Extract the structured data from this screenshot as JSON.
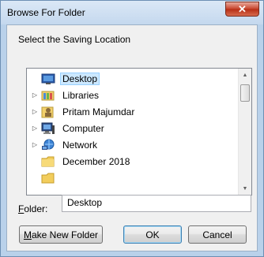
{
  "window": {
    "title": "Browse For Folder",
    "close_glyph": "✕"
  },
  "prompt": "Select the Saving Location",
  "tree": {
    "items": [
      {
        "label": "Desktop",
        "icon": "desktop-icon",
        "expander": "",
        "selected": true
      },
      {
        "label": "Libraries",
        "icon": "libraries-icon",
        "expander": "▷"
      },
      {
        "label": "Pritam Majumdar",
        "icon": "user-folder-icon",
        "expander": "▷"
      },
      {
        "label": "Computer",
        "icon": "computer-icon",
        "expander": "▷"
      },
      {
        "label": "Network",
        "icon": "network-icon",
        "expander": "▷"
      },
      {
        "label": "December 2018",
        "icon": "folder-icon",
        "expander": ""
      }
    ]
  },
  "folder": {
    "label_prefix": "F",
    "label_rest": "older:",
    "value": "Desktop"
  },
  "buttons": {
    "make_new_folder_mnemonic": "M",
    "make_new_folder_rest": "ake New Folder",
    "ok": "OK",
    "cancel": "Cancel"
  },
  "colors": {
    "selection": "#cce8ff",
    "title_bar": "#c4d8ee",
    "close": "#c7432b"
  }
}
